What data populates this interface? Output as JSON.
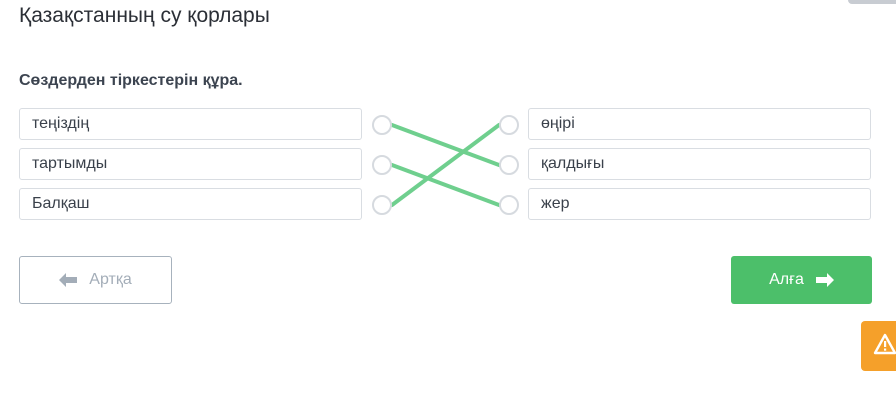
{
  "page": {
    "title": "Қазақстанның су қорлары",
    "instruction": "Сөздерден тіркестерін құра."
  },
  "left_words": [
    "теңіздің",
    "тартымды",
    "Балқаш"
  ],
  "right_words": [
    "өңірі",
    "қалдығы",
    "жер"
  ],
  "connections": [
    [
      0,
      1
    ],
    [
      1,
      2
    ],
    [
      2,
      0
    ]
  ],
  "colors": {
    "link": "#6fcf8e",
    "next_button": "#4cbf6a",
    "warning": "#f5a02a"
  },
  "buttons": {
    "back_label": "Артқа",
    "next_label": "Алға"
  },
  "icons": {
    "back": "arrow-left-icon",
    "next": "arrow-right-icon",
    "warning": "warning-triangle-icon"
  }
}
